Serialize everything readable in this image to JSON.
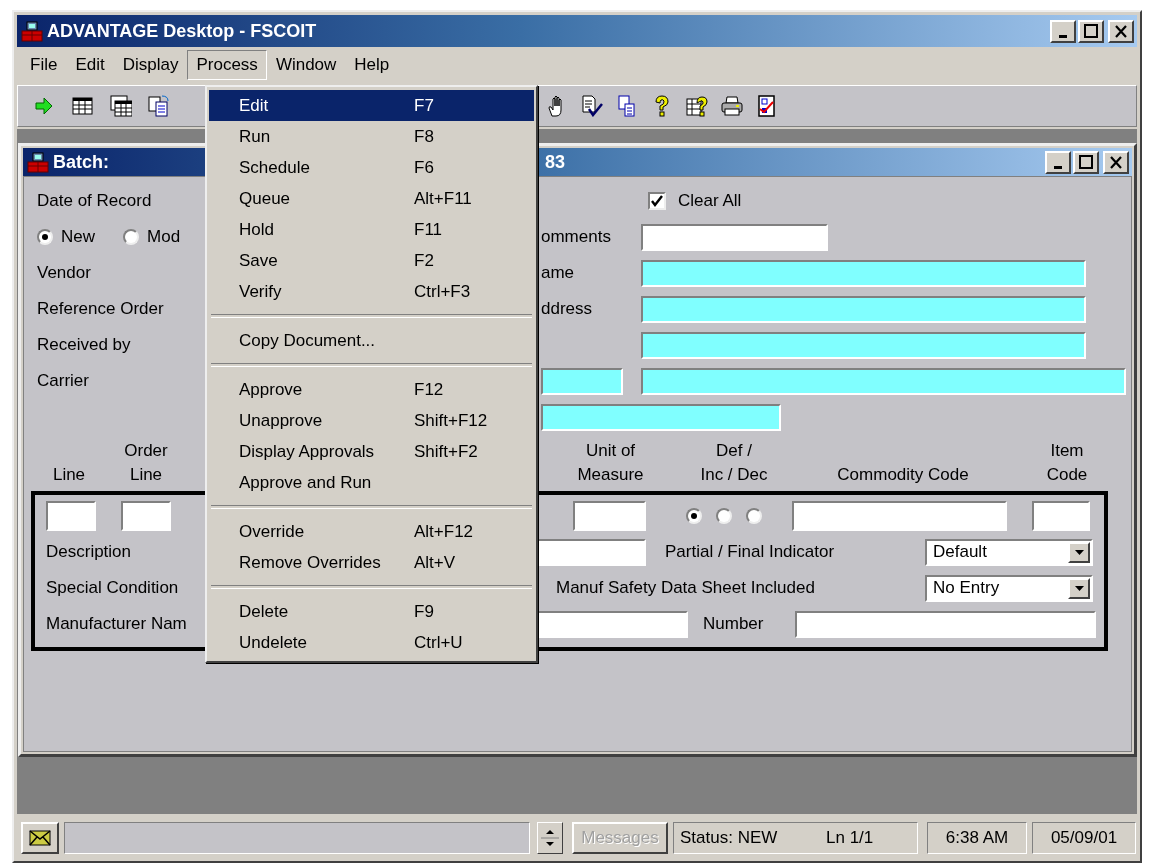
{
  "window": {
    "title": "ADVANTAGE Desktop - FSCOIT"
  },
  "menu_bar": [
    {
      "label": "File",
      "selected": false
    },
    {
      "label": "Edit",
      "selected": false
    },
    {
      "label": "Display",
      "selected": false
    },
    {
      "label": "Process",
      "selected": true
    },
    {
      "label": "Window",
      "selected": false
    },
    {
      "label": "Help",
      "selected": false
    }
  ],
  "process_menu": [
    {
      "items": [
        {
          "label": "Edit",
          "shortcut": "F7",
          "selected": true
        },
        {
          "label": "Run",
          "shortcut": "F8",
          "selected": false
        },
        {
          "label": "Schedule",
          "shortcut": "F6",
          "selected": false
        },
        {
          "label": "Queue",
          "shortcut": "Alt+F11",
          "selected": false
        },
        {
          "label": "Hold",
          "shortcut": "F11",
          "selected": false
        },
        {
          "label": "Save",
          "shortcut": "F2",
          "selected": false
        },
        {
          "label": "Verify",
          "shortcut": "Ctrl+F3",
          "selected": false
        }
      ]
    },
    {
      "items": [
        {
          "label": "Copy Document...",
          "selected": false
        }
      ]
    },
    {
      "items": [
        {
          "label": "Approve",
          "shortcut": "F12",
          "selected": false
        },
        {
          "label": "Unapprove",
          "shortcut": "Shift+F12",
          "selected": false
        },
        {
          "label": "Display Approvals",
          "shortcut": "Shift+F2",
          "selected": false
        },
        {
          "label": "Approve and Run",
          "selected": false
        }
      ]
    },
    {
      "items": [
        {
          "label": "Override",
          "shortcut": "Alt+F12",
          "selected": false
        },
        {
          "label": "Remove Overrides",
          "shortcut": "Alt+V",
          "selected": false
        }
      ]
    },
    {
      "items": [
        {
          "label": "Delete",
          "shortcut": "F9",
          "selected": false
        },
        {
          "label": "Undelete",
          "shortcut": "Ctrl+U",
          "selected": false
        }
      ]
    }
  ],
  "batch_window": {
    "title": "Batch:",
    "title_tail": "83"
  },
  "header_rows": [
    {
      "left": {
        "kind": "label",
        "text": "Date of Record"
      },
      "right": {
        "kind": "checkbox",
        "label": "Clear All",
        "checked": true
      }
    },
    {
      "left": {
        "kind": "radios",
        "options": [
          {
            "label": "New",
            "selected": true
          },
          {
            "label": "Mod",
            "selected": false
          }
        ]
      },
      "right": {
        "kind": "field",
        "label": "omments",
        "required": false
      }
    },
    {
      "left": {
        "kind": "label",
        "text": "Vendor"
      },
      "right": {
        "kind": "field",
        "label": "ame",
        "required": true
      }
    },
    {
      "left": {
        "kind": "label",
        "text": "Reference Order"
      },
      "right": {
        "kind": "field",
        "label": "ddress",
        "required": true
      }
    },
    {
      "left": {
        "kind": "label",
        "text": "Received by"
      },
      "right": {
        "kind": "field",
        "required": true
      }
    },
    {
      "left": {
        "kind": "label",
        "text": "Carrier"
      },
      "right": {
        "kind": "field_pair",
        "fields": [
          {
            "required": true
          },
          {
            "required": true
          }
        ]
      }
    },
    {
      "right": {
        "kind": "wide_field",
        "required": true
      }
    }
  ],
  "line_columns": [
    "Line",
    "Order\nLine",
    "Unit of\nMeasure",
    "Def /\nInc / Dec",
    "Commodity Code",
    "Item\nCode"
  ],
  "line_item": {
    "entry": [
      {
        "kind": "field"
      },
      {
        "kind": "field"
      },
      {
        "kind": "field"
      },
      {
        "kind": "radios",
        "options": [
          {
            "selected": true
          },
          {
            "selected": false
          },
          {
            "selected": false
          }
        ]
      },
      {
        "kind": "field"
      },
      {
        "kind": "field"
      }
    ],
    "description_label": "Description",
    "partial_final": {
      "label": "Partial / Final Indicator",
      "value": "Default"
    },
    "special_condition_label": "Special Condition",
    "msds": {
      "label": "Manuf Safety Data Sheet Included",
      "value": "No Entry"
    },
    "manufacturer_label": "Manufacturer Nam",
    "number_label": "Number"
  },
  "status_bar": {
    "messages": {
      "label": "Messages",
      "disabled": true
    },
    "status": "Status: NEW",
    "line": "Ln 1/1",
    "time": "6:38 AM",
    "date": "05/09/01"
  }
}
